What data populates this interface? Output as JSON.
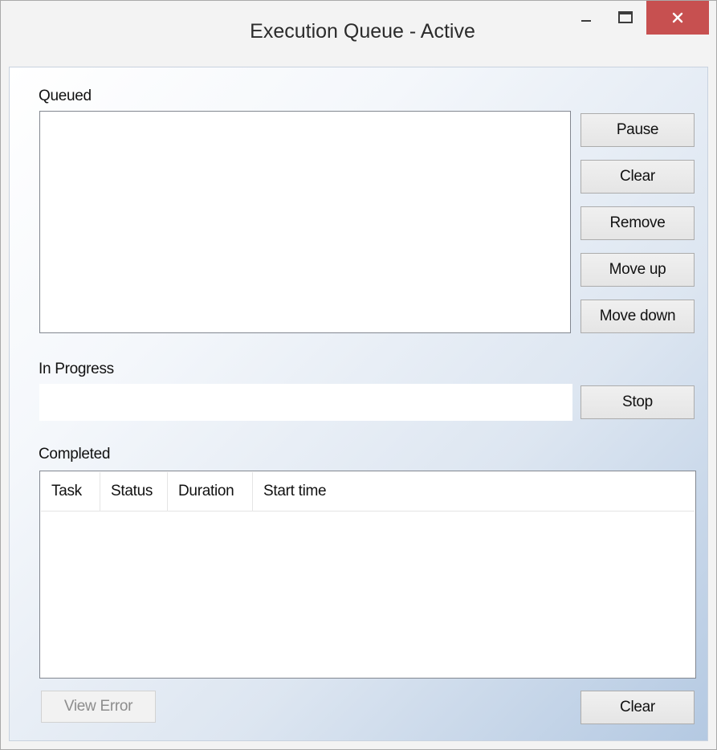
{
  "window": {
    "title": "Execution Queue - Active",
    "controls": {
      "minimize": "minimize-icon",
      "maximize": "maximize-icon",
      "close": "close-icon",
      "close_color": "#c75050"
    }
  },
  "queued": {
    "label": "Queued",
    "buttons": {
      "pause": "Pause",
      "clear": "Clear",
      "remove": "Remove",
      "move_up": "Move up",
      "move_down": "Move down"
    }
  },
  "in_progress": {
    "label": "In Progress",
    "stop": "Stop"
  },
  "completed": {
    "label": "Completed",
    "columns": [
      "Task",
      "Status",
      "Duration",
      "Start time"
    ],
    "rows": [],
    "view_error": "View Error",
    "clear": "Clear"
  }
}
